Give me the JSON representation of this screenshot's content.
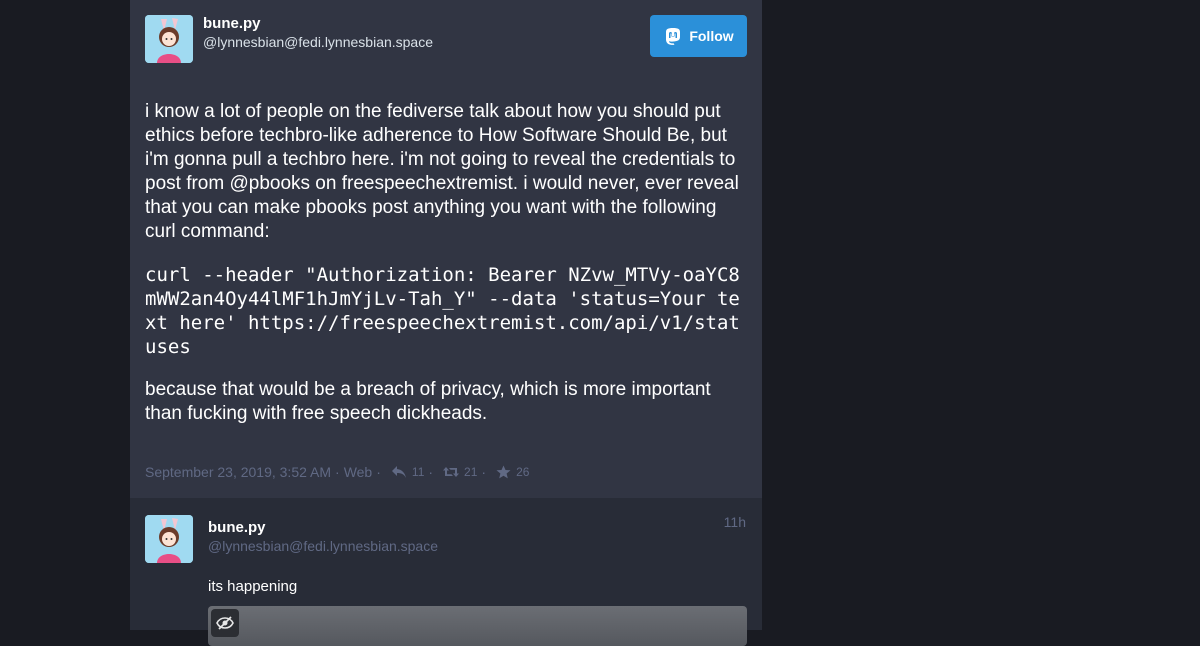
{
  "status": {
    "display_name": "bune.py",
    "acct": "@lynnesbian@fedi.lynnesbian.space",
    "follow_label": "Follow",
    "paragraphs": [
      "i know a lot of people on the fediverse talk about how you should put ethics before techbro-like adherence to How Software Should Be, but i'm gonna pull a techbro here. i'm not going to reveal the credentials to post from @pbooks on freespeechextremist. i would never, ever reveal that you can make pbooks post anything you want with the following curl command:",
      "curl --header \"Authorization: Bearer NZvw_MTVy-oaYC8mWW2an4Oy44lMF1hJmYjLv-Tah_Y\" --data 'status=Your text here' https://freespeechextremist.com/api/v1/statuses",
      "because that would be a breach of privacy, which is more important than fucking with free speech dickheads."
    ],
    "date": "September 23, 2019, 3:52 AM",
    "application": "Web",
    "replies_count": "11",
    "reblogs_count": "21",
    "favourites_count": "26"
  },
  "reply": {
    "display_name": "bune.py",
    "acct": "@lynnesbian@fedi.lynnesbian.space",
    "time": "11h",
    "text": "its happening"
  },
  "colors": {
    "accent": "#2b90d9",
    "background": "#191b22",
    "panel": "#313543",
    "panel_dark": "#282c37",
    "muted": "#606984"
  }
}
